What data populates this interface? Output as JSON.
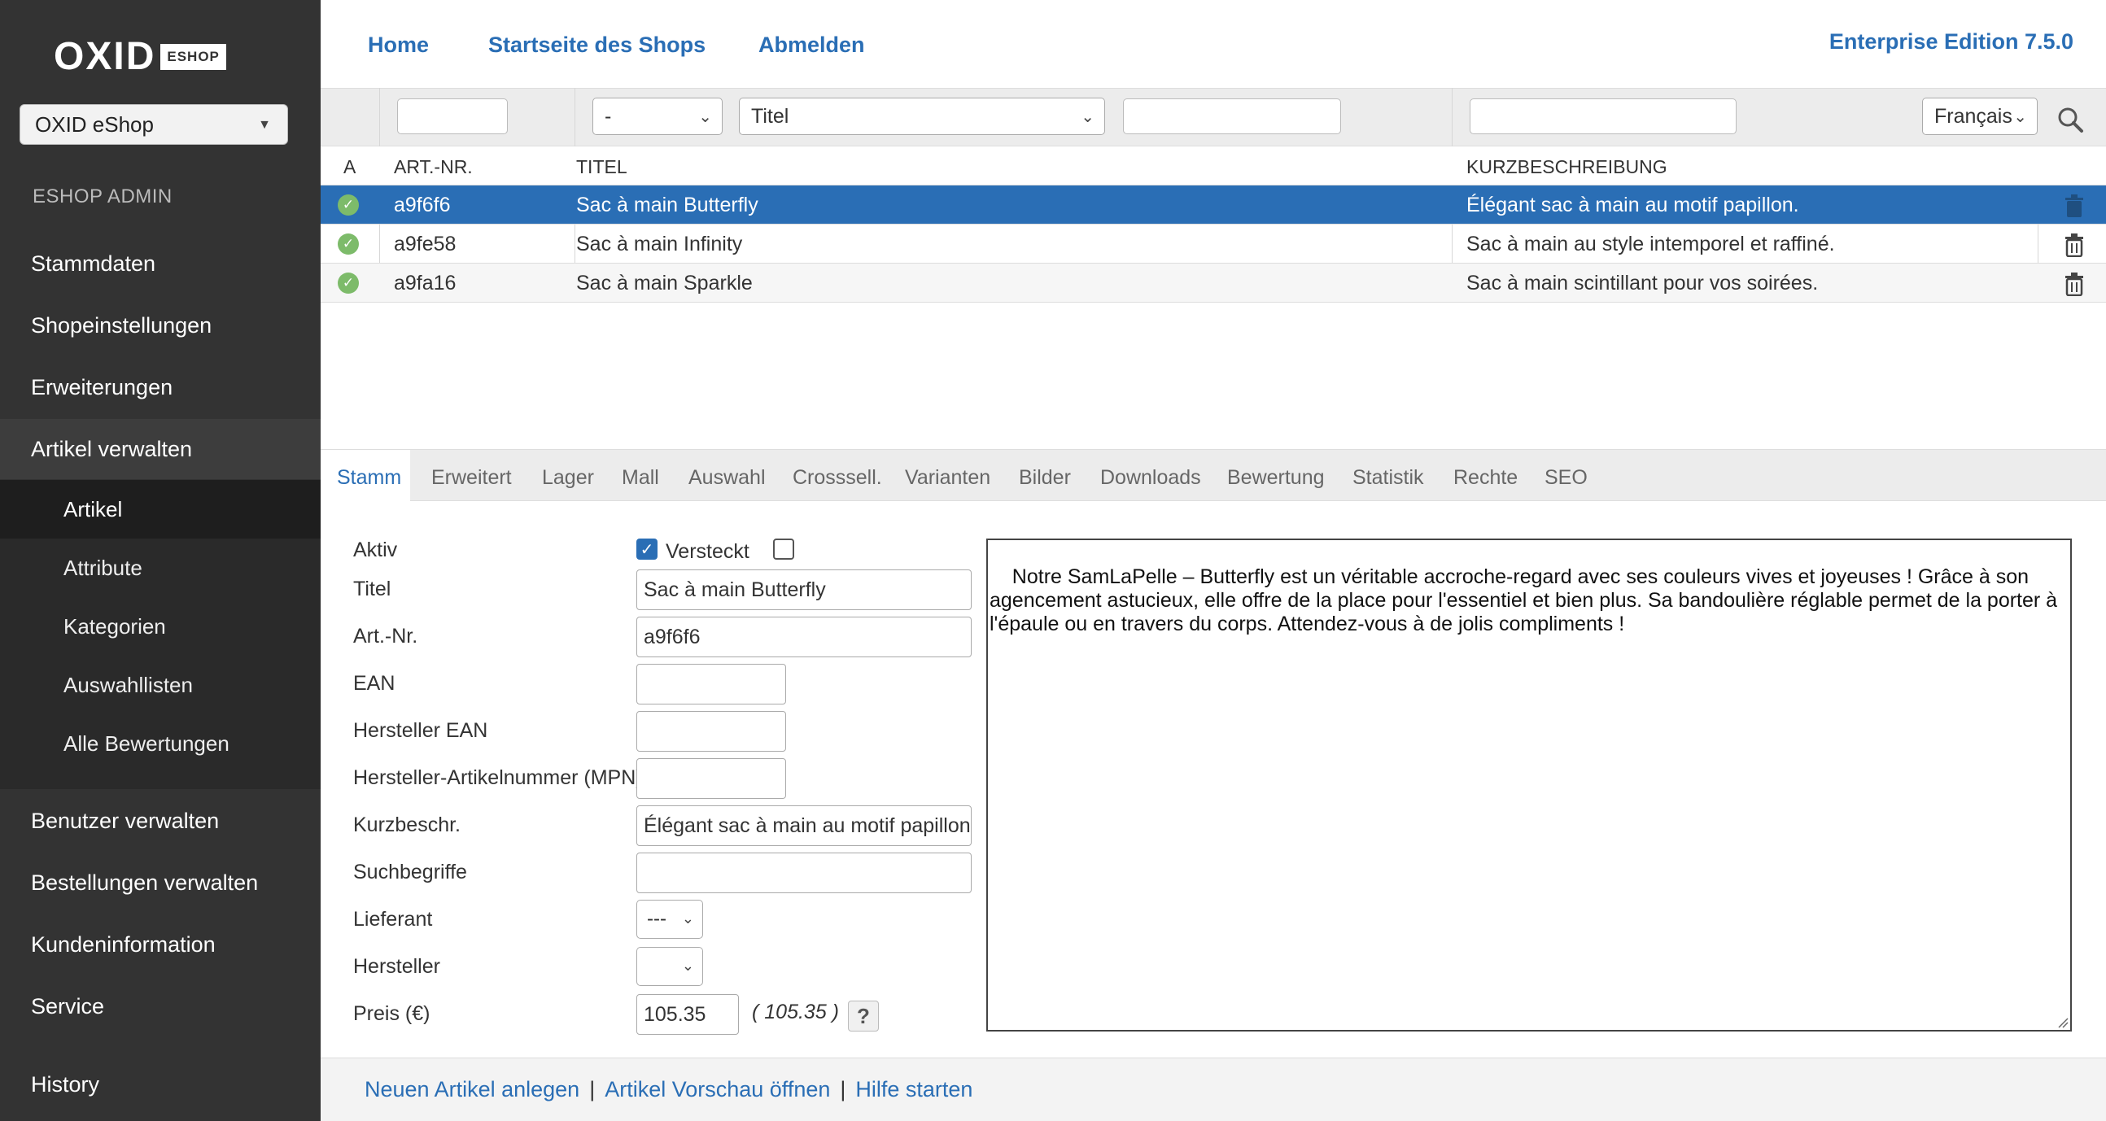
{
  "sidebar": {
    "logo_text": "OXID",
    "logo_badge": "ESHOP",
    "shop_select": "OXID eShop",
    "section_label": "ESHOP ADMIN",
    "nav": [
      {
        "label": "Stammdaten"
      },
      {
        "label": "Shopeinstellungen"
      },
      {
        "label": "Erweiterungen"
      },
      {
        "label": "Artikel verwalten"
      }
    ],
    "subnav": [
      {
        "label": "Artikel"
      },
      {
        "label": "Attribute"
      },
      {
        "label": "Kategorien"
      },
      {
        "label": "Auswahllisten"
      },
      {
        "label": "Alle Bewertungen"
      }
    ],
    "nav2": [
      {
        "label": "Benutzer verwalten"
      },
      {
        "label": "Bestellungen verwalten"
      },
      {
        "label": "Kundeninformation"
      },
      {
        "label": "Service"
      },
      {
        "label": "History"
      }
    ]
  },
  "header": {
    "links": [
      "Home",
      "Startseite des Shops",
      "Abmelden"
    ],
    "edition": "Enterprise Edition 7.5.0"
  },
  "filters": {
    "category_select": "-",
    "field_select": "Titel",
    "language_select": "Français"
  },
  "table": {
    "headers": [
      "A",
      "ART.-NR.",
      "TITEL",
      "KURZBESCHREIBUNG"
    ],
    "rows": [
      {
        "artnum": "a9f6f6",
        "title": "Sac à main Butterfly",
        "desc": "Élégant sac à main au motif papillon."
      },
      {
        "artnum": "a9fe58",
        "title": "Sac à main Infinity",
        "desc": "Sac à main au style intemporel et raffiné."
      },
      {
        "artnum": "a9fa16",
        "title": "Sac à main Sparkle",
        "desc": "Sac à main scintillant pour vos soirées."
      }
    ]
  },
  "tabs": [
    "Stamm",
    "Erweitert",
    "Lager",
    "Mall",
    "Auswahl",
    "Crosssell.",
    "Varianten",
    "Bilder",
    "Downloads",
    "Bewertung",
    "Statistik",
    "Rechte",
    "SEO"
  ],
  "form": {
    "labels": {
      "aktiv": "Aktiv",
      "versteckt": "Versteckt",
      "titel": "Titel",
      "artnr": "Art.-Nr.",
      "ean": "EAN",
      "hersteller_ean": "Hersteller EAN",
      "mpn": "Hersteller-Artikelnummer (MPN)",
      "kurz": "Kurzbeschr.",
      "such": "Suchbegriffe",
      "lieferant": "Lieferant",
      "hersteller": "Hersteller",
      "preis": "Preis (€)"
    },
    "values": {
      "titel": "Sac à main Butterfly",
      "artnr": "a9f6f6",
      "ean": "",
      "hersteller_ean": "",
      "mpn": "",
      "kurz": "Élégant sac à main au motif papillon.",
      "such": "",
      "lieferant": "---",
      "hersteller": "",
      "preis": "105.35",
      "brutto": "( 105.35 )",
      "help": "?"
    },
    "long_description": "Notre SamLaPelle – Butterfly est un véritable accroche-regard avec ses couleurs vives et joyeuses ! Grâce à son agencement astucieux, elle offre de la place pour l'essentiel et bien plus. Sa bandoulière réglable permet de la porter à l'épaule ou en travers du corps. Attendez-vous à de jolis compliments !"
  },
  "footer": {
    "links": [
      "Neuen Artikel anlegen",
      "Artikel Vorschau öffnen",
      "Hilfe starten"
    ],
    "separator": "|"
  },
  "colors": {
    "sidebar_bg": "#333333",
    "accent": "#2a6eb5",
    "active_check": "#7dbb6a"
  }
}
